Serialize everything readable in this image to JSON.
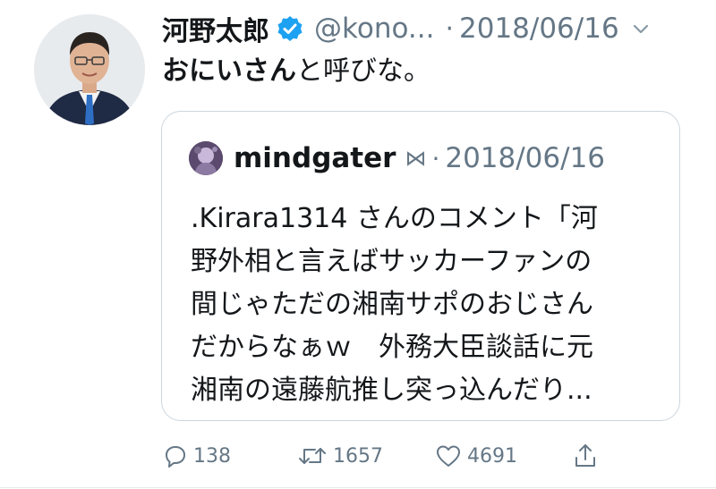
{
  "author": {
    "display_name": "河野太郎",
    "handle": "@kono...",
    "separator": "·",
    "date": "2018/06/16",
    "verified": true
  },
  "tweet": {
    "text_bold": "おにいさん",
    "text_rest": "と呼びな。"
  },
  "quote": {
    "name": "mindgater",
    "mark": "⋈",
    "separator": "·",
    "date": "2018/06/16",
    "lines": [
      ".Kirara1314 さんのコメント「河",
      "野外相と言えばサッカーファンの",
      "間じゃただの湘南サポのおじさん",
      "だからなぁｗ　外務大臣談話に元",
      "湘南の遠藤航推し突っ込んだり..."
    ]
  },
  "actions": {
    "reply": {
      "icon": "reply-icon",
      "count": "138"
    },
    "retweet": {
      "icon": "retweet-icon",
      "count": "1657"
    },
    "like": {
      "icon": "heart-icon",
      "count": "4691"
    },
    "share": {
      "icon": "share-icon"
    }
  },
  "colors": {
    "verified": "#1da1f2",
    "secondary_text": "#657786",
    "border": "#ccd6dd"
  }
}
